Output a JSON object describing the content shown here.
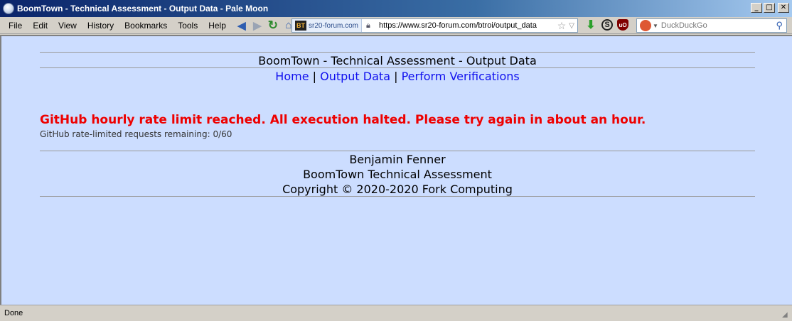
{
  "window": {
    "title": "BoomTown - Technical Assessment - Output Data - Pale Moon",
    "minimize": "_",
    "maximize": "□",
    "close": "✕"
  },
  "menu": {
    "file": "File",
    "edit": "Edit",
    "view": "View",
    "history": "History",
    "bookmarks": "Bookmarks",
    "tools": "Tools",
    "help": "Help"
  },
  "address": {
    "site_badge": "sr20-forum.com",
    "url": "https://www.sr20-forum.com/btroi/output_data"
  },
  "search": {
    "placeholder": "DuckDuckGo"
  },
  "page": {
    "header_title": "BoomTown - Technical Assessment - Output Data",
    "nav": {
      "home": "Home",
      "output_data": "Output Data",
      "perform_verifications": "Perform Verifications",
      "separator": "|"
    },
    "error_message": "GitHub hourly rate limit reached. All execution halted. Please try again in about an hour.",
    "remaining_text": "GitHub rate-limited requests remaining: 0/60",
    "footer": {
      "author": "Benjamin Fenner",
      "project": "BoomTown Technical Assessment",
      "copyright": "Copyright © 2020-2020 Fork Computing"
    }
  },
  "status": {
    "text": "Done"
  },
  "icons": {
    "app": "pale-moon-icon",
    "back": "back-arrow-icon",
    "forward": "forward-arrow-icon",
    "reload": "reload-icon",
    "home": "home-icon",
    "lock": "lock-icon",
    "star": "bookmark-star-icon",
    "download": "download-arrow-icon",
    "sync": "s-extension-icon",
    "ublock": "ublock-icon",
    "search_engine": "duckduckgo-icon",
    "magnifier": "search-icon"
  },
  "colors": {
    "page_bg": "#ccddff",
    "error": "#ee0000",
    "link": "#1010ee"
  }
}
